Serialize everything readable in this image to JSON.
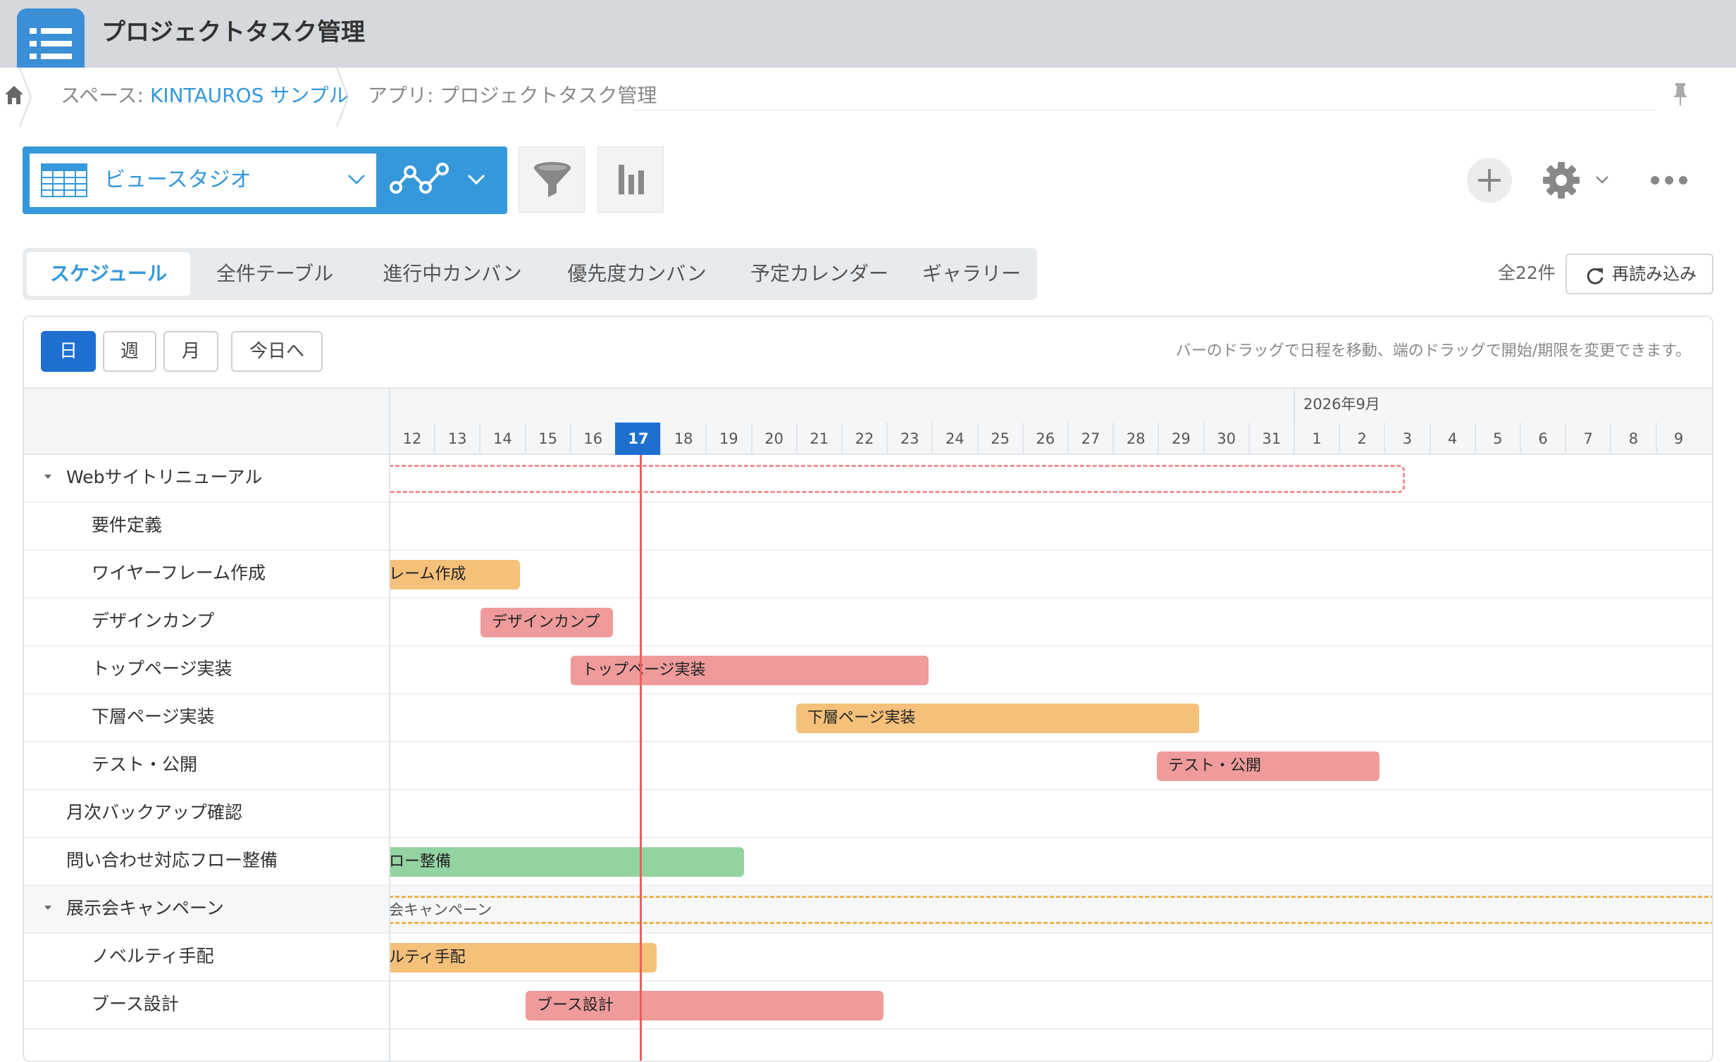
{
  "app": {
    "title": "プロジェクトタスク管理"
  },
  "breadcrumb": {
    "space_prefix": "スペース: ",
    "space_name": "KINTAUROS サンプル",
    "app_prefix": "アプリ: ",
    "app_name": "プロジェクトタスク管理"
  },
  "toolbar": {
    "view_name": "ビュースタジオ",
    "icons": [
      "grid-icon",
      "chevron-down-icon",
      "graph-icon",
      "filter-icon",
      "bar-chart-icon",
      "plus-icon",
      "gear-icon",
      "more-icon"
    ]
  },
  "tabs": [
    {
      "label": "スケジュール",
      "active": true
    },
    {
      "label": "全件テーブル",
      "active": false
    },
    {
      "label": "進行中カンバン",
      "active": false
    },
    {
      "label": "優先度カンバン",
      "active": false
    },
    {
      "label": "予定カレンダー",
      "active": false
    },
    {
      "label": "ギャラリー",
      "active": false
    }
  ],
  "summary": {
    "total": "全22件",
    "reload": "再読み込み"
  },
  "gantt": {
    "scales": [
      "日",
      "週",
      "月",
      "今日へ"
    ],
    "active_scale": "日",
    "hint": "バーのドラッグで日程を移動、端のドラッグで開始/期限を変更できます。",
    "month_label": "2026年9月",
    "days": [
      "12",
      "13",
      "14",
      "15",
      "16",
      "17",
      "18",
      "19",
      "20",
      "21",
      "22",
      "23",
      "24",
      "25",
      "26",
      "27",
      "28",
      "29",
      "30",
      "31",
      "1",
      "2",
      "3",
      "4",
      "5",
      "6",
      "7",
      "8",
      "9"
    ],
    "today": "17",
    "rows": [
      {
        "label": "Webサイトリニューアル",
        "group": true
      },
      {
        "label": "要件定義"
      },
      {
        "label": "ワイヤーフレーム作成",
        "bar_text": "レーム作成"
      },
      {
        "label": "デザインカンプ",
        "bar_text": "デザインカンプ"
      },
      {
        "label": "トップページ実装",
        "bar_text": "トップページ実装"
      },
      {
        "label": "下層ページ実装",
        "bar_text": "下層ページ実装"
      },
      {
        "label": "テスト・公開",
        "bar_text": "テスト・公開"
      },
      {
        "label": "月次バックアップ確認"
      },
      {
        "label": "問い合わせ対応フロー整備",
        "bar_text": "ロー整備"
      },
      {
        "label": "展示会キャンペーン",
        "group": true,
        "bar_text": "会キャンペーン"
      },
      {
        "label": "ノベルティ手配",
        "bar_text": "ルティ手配"
      },
      {
        "label": "ブース設計",
        "bar_text": "ブース設計"
      }
    ]
  },
  "colors": {
    "accent": "#3498db",
    "today": "#1e6fd0",
    "bar_orange": "#f4c07a",
    "bar_red": "#ef9b9b",
    "bar_green": "#93d3a2"
  }
}
